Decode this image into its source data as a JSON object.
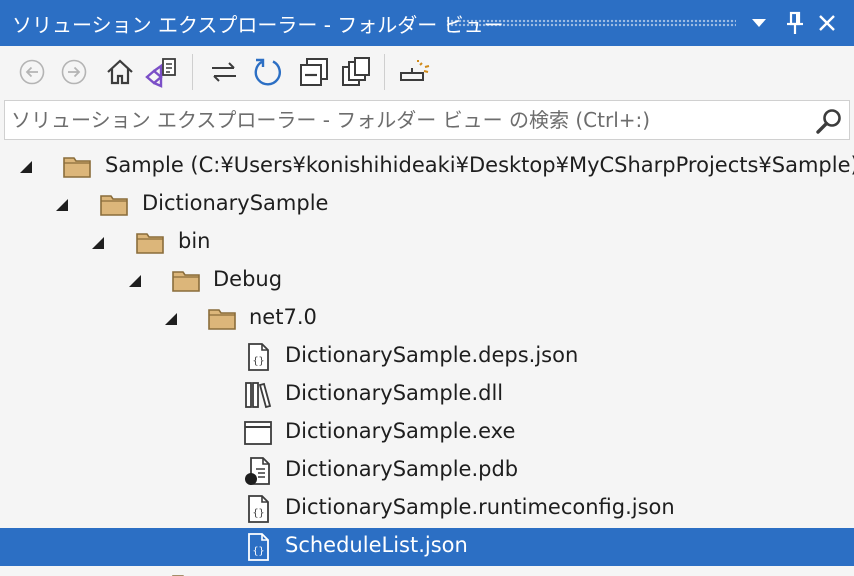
{
  "window": {
    "title": "ソリューション エクスプローラー - フォルダー ビュー",
    "buttons": [
      "menu-dropdown",
      "pin",
      "close"
    ]
  },
  "toolbar": {
    "items": [
      "back-icon",
      "forward-icon",
      "home-icon",
      "switch-views-icon",
      "sync-icon",
      "refresh-icon",
      "collapse-all-icon",
      "show-all-files-icon",
      "properties-icon"
    ]
  },
  "search": {
    "placeholder": "ソリューション エクスプローラー - フォルダー ビュー の検索 (Ctrl+:)",
    "value": ""
  },
  "tree": {
    "rows": [
      {
        "label": "Sample (C:¥Users¥konishihideaki¥Desktop¥MyCSharpProjects¥Sample)",
        "type": "folder",
        "expanded": true
      },
      {
        "label": "DictionarySample",
        "type": "folder",
        "expanded": true
      },
      {
        "label": "bin",
        "type": "folder",
        "expanded": true
      },
      {
        "label": "Debug",
        "type": "folder",
        "expanded": true
      },
      {
        "label": "net7.0",
        "type": "folder",
        "expanded": true
      },
      {
        "label": "DictionarySample.deps.json",
        "type": "json"
      },
      {
        "label": "DictionarySample.dll",
        "type": "dll"
      },
      {
        "label": "DictionarySample.exe",
        "type": "exe"
      },
      {
        "label": "DictionarySample.pdb",
        "type": "pdb"
      },
      {
        "label": "DictionarySample.runtimeconfig.json",
        "type": "json"
      },
      {
        "label": "ScheduleList.json",
        "type": "json",
        "selected": true
      },
      {
        "label": "",
        "type": "folder",
        "expanded": false
      }
    ]
  },
  "colors": {
    "accent": "#2c6fc4",
    "folder": "#dcb67a",
    "folder_stroke": "#8a6d3b"
  }
}
